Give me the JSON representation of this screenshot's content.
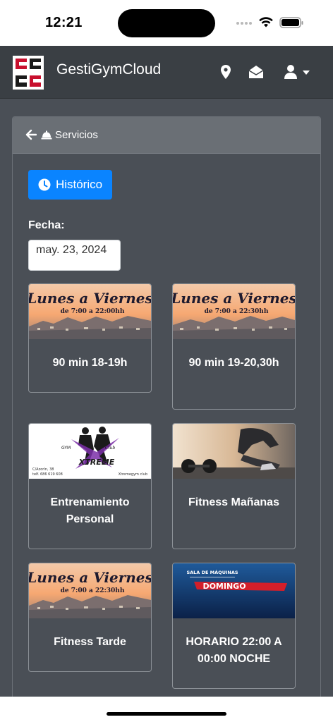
{
  "status_bar": {
    "time": "12:21"
  },
  "navbar": {
    "brand": "GestiGymCloud",
    "bg_color": "#3a3f44",
    "icons": [
      "map-marker-icon",
      "envelope-open-icon",
      "user-icon",
      "caret-down-icon"
    ]
  },
  "card": {
    "title": "Servicios",
    "back_icon": "arrow-left-icon",
    "title_icon": "bell-icon"
  },
  "historico_button": {
    "label": "Histórico",
    "icon": "clock-icon",
    "color": "#0a84ff"
  },
  "fecha": {
    "label": "Fecha:",
    "value": "may. 23, 2024"
  },
  "services": [
    {
      "label": "90 min 18-19h",
      "banner_title": "Lunes a Viernes",
      "banner_sub": "de 7:00 a 22:00hh"
    },
    {
      "label": "90 min 19-20,30h",
      "banner_title": "Lunes a Viernes",
      "banner_sub": "de 7:00 a 22:30hh"
    },
    {
      "label": "Entrenamiento Personal",
      "banner_brand": "XTREME",
      "banner_gym": "GYM",
      "banner_club": "Club",
      "banner_address": "C/Azorín, 38",
      "banner_phone": "telf. 686 619 608",
      "banner_social": "Xtremegym club"
    },
    {
      "label": "Fitness Mañanas"
    },
    {
      "label": "Fitness Tarde",
      "banner_title": "Lunes a Viernes",
      "banner_sub": "de 7:00 a 22:30hh"
    },
    {
      "label": "HORARIO 22:00 A 00:00 NOCHE",
      "banner_top": "SALA DE MÁQUINAS",
      "banner_day": "DOMINGO"
    }
  ],
  "colors": {
    "content_bg": "#4a4f56",
    "card_header_bg": "#6a6f75",
    "text": "#ffffff"
  }
}
